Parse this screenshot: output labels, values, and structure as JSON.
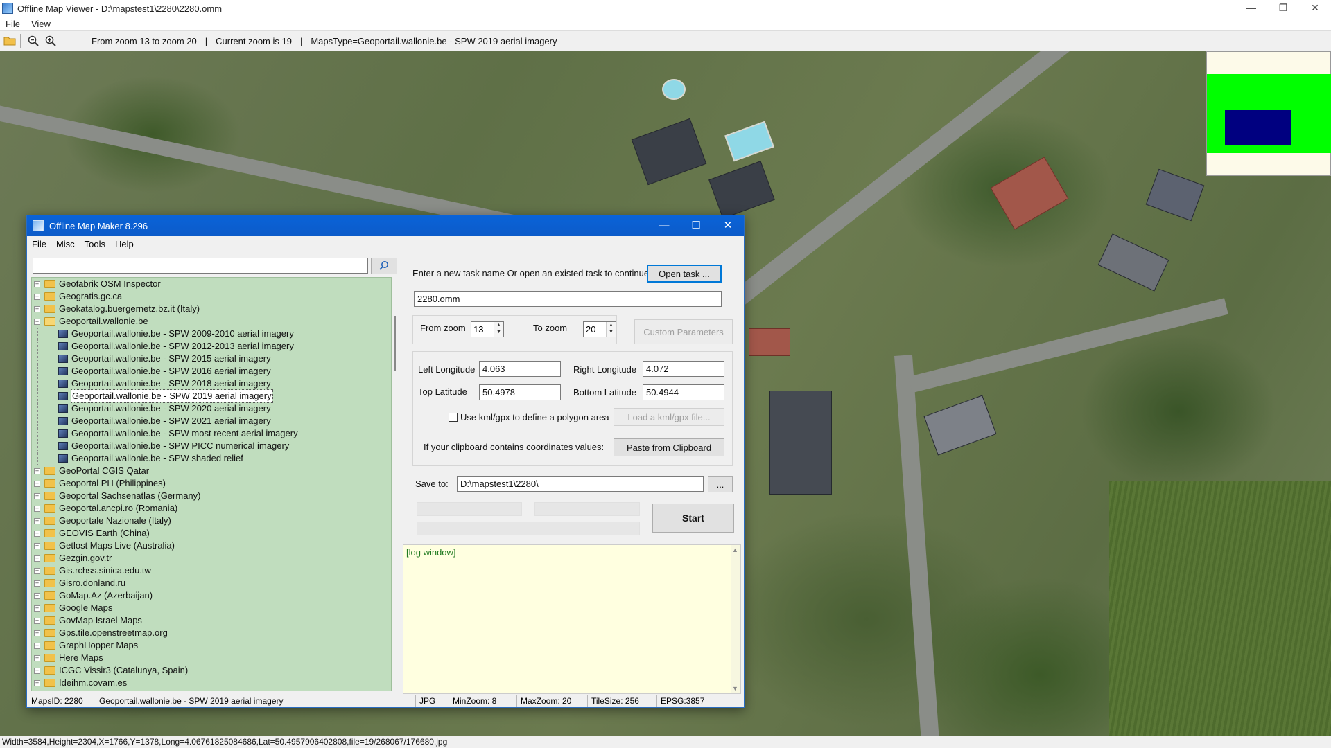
{
  "viewer": {
    "title": "Offline Map Viewer - D:\\mapstest1\\2280\\2280.omm",
    "controls": {
      "minimize": "—",
      "restore": "❐",
      "close": "✕"
    },
    "menu": [
      "File",
      "View"
    ],
    "toolbar": {
      "zoom_range": "From zoom 13 to zoom 20",
      "sep": "|",
      "current_zoom": "Current zoom is 19",
      "maps_type": "MapsType=Geoportail.wallonie.be - SPW 2019 aerial imagery"
    },
    "status": "Width=3584,Height=2304,X=1766,Y=1378,Long=4.06761825084686,Lat=50.4957906402808,file=19/268067/176680.jpg"
  },
  "minimap": {
    "bg": "#fdfae9",
    "green": "#00ff00",
    "blue": "#000080"
  },
  "dialog": {
    "title": "Offline Map Maker 8.296",
    "controls": {
      "minimize": "—",
      "maximize": "☐",
      "close": "✕"
    },
    "menu": [
      "File",
      "Misc",
      "Tools",
      "Help"
    ],
    "search": {
      "value": "",
      "button_icon": "search-icon"
    },
    "tree": [
      {
        "label": "Geofabrik OSM Inspector",
        "kind": "folder",
        "state": "+"
      },
      {
        "label": "Geogratis.gc.ca",
        "kind": "folder",
        "state": "+"
      },
      {
        "label": "Geokatalog.buergernetz.bz.it (Italy)",
        "kind": "folder",
        "state": "+"
      },
      {
        "label": "Geoportail.wallonie.be",
        "kind": "folder",
        "state": "−"
      },
      {
        "label": "Geoportail.wallonie.be - SPW 2009-2010 aerial imagery",
        "kind": "map"
      },
      {
        "label": "Geoportail.wallonie.be - SPW 2012-2013 aerial imagery",
        "kind": "map"
      },
      {
        "label": "Geoportail.wallonie.be - SPW 2015 aerial imagery",
        "kind": "map"
      },
      {
        "label": "Geoportail.wallonie.be - SPW 2016 aerial imagery",
        "kind": "map"
      },
      {
        "label": "Geoportail.wallonie.be - SPW 2018 aerial imagery",
        "kind": "map"
      },
      {
        "label": "Geoportail.wallonie.be - SPW 2019 aerial imagery",
        "kind": "map",
        "selected": true
      },
      {
        "label": "Geoportail.wallonie.be - SPW 2020 aerial imagery",
        "kind": "map"
      },
      {
        "label": "Geoportail.wallonie.be - SPW 2021 aerial imagery",
        "kind": "map"
      },
      {
        "label": "Geoportail.wallonie.be - SPW most recent aerial imagery",
        "kind": "map"
      },
      {
        "label": "Geoportail.wallonie.be - SPW PICC numerical imagery",
        "kind": "map"
      },
      {
        "label": "Geoportail.wallonie.be - SPW shaded relief",
        "kind": "map"
      },
      {
        "label": "GeoPortal CGIS Qatar",
        "kind": "folder",
        "state": "+"
      },
      {
        "label": "Geoportal PH (Philippines)",
        "kind": "folder",
        "state": "+"
      },
      {
        "label": "Geoportal Sachsenatlas (Germany)",
        "kind": "folder",
        "state": "+"
      },
      {
        "label": "Geoportal.ancpi.ro (Romania)",
        "kind": "folder",
        "state": "+"
      },
      {
        "label": "Geoportale Nazionale (Italy)",
        "kind": "folder",
        "state": "+"
      },
      {
        "label": "GEOVIS Earth (China)",
        "kind": "folder",
        "state": "+"
      },
      {
        "label": "Getlost Maps Live (Australia)",
        "kind": "folder",
        "state": "+"
      },
      {
        "label": "Gezgin.gov.tr",
        "kind": "folder",
        "state": "+"
      },
      {
        "label": "Gis.rchss.sinica.edu.tw",
        "kind": "folder",
        "state": "+"
      },
      {
        "label": "Gisro.donland.ru",
        "kind": "folder",
        "state": "+"
      },
      {
        "label": "GoMap.Az (Azerbaijan)",
        "kind": "folder",
        "state": "+"
      },
      {
        "label": "Google Maps",
        "kind": "folder",
        "state": "+"
      },
      {
        "label": "GovMap Israel Maps",
        "kind": "folder",
        "state": "+"
      },
      {
        "label": "Gps.tile.openstreetmap.org",
        "kind": "folder",
        "state": "+"
      },
      {
        "label": "GraphHopper Maps",
        "kind": "folder",
        "state": "+"
      },
      {
        "label": "Here Maps",
        "kind": "folder",
        "state": "+"
      },
      {
        "label": "ICGC Vissir3 (Catalunya, Spain)",
        "kind": "folder",
        "state": "+"
      },
      {
        "label": "Ideihm.covam.es",
        "kind": "folder",
        "state": "+"
      }
    ],
    "task": {
      "prompt": "Enter a new task name Or open an existed task to continue:",
      "open_button": "Open task ...",
      "name_value": "2280.omm"
    },
    "zoom": {
      "from_label": "From zoom",
      "from_value": "13",
      "to_label": "To zoom",
      "to_value": "20",
      "custom_button": "Custom Parameters"
    },
    "coords": {
      "left_lon_label": "Left Longitude",
      "left_lon_value": "4.063",
      "right_lon_label": "Right Longitude",
      "right_lon_value": "4.072",
      "top_lat_label": "Top Latitude",
      "top_lat_value": "50.4978",
      "bottom_lat_label": "Bottom Latitude",
      "bottom_lat_value": "50.4944",
      "kml_label": "Use kml/gpx to define a polygon area",
      "kml_button": "Load a kml/gpx file...",
      "clipboard_label": "If your clipboard contains coordinates values:",
      "clipboard_button": "Paste from Clipboard"
    },
    "save": {
      "label": "Save to:",
      "value": "D:\\mapstest1\\2280\\",
      "browse_button": "...",
      "start_button": "Start"
    },
    "log": {
      "text": "[log window]"
    },
    "status": {
      "maps_id": "MapsID: 2280",
      "maps_name": "Geoportail.wallonie.be - SPW 2019 aerial imagery",
      "format": "JPG",
      "min_zoom": "MinZoom: 8",
      "max_zoom": "MaxZoom: 20",
      "tile_size": "TileSize: 256",
      "epsg": "EPSG:3857"
    }
  }
}
